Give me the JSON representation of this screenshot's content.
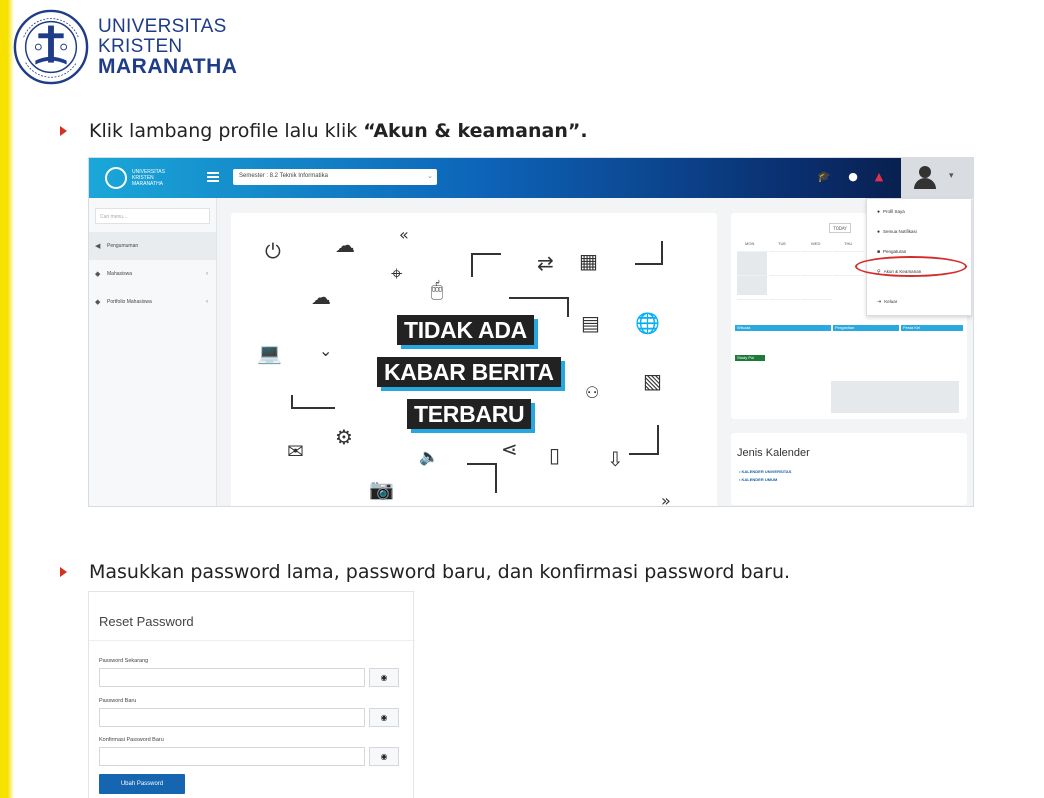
{
  "brand": {
    "line1": "UNIVERSITAS",
    "line2": "KRISTEN",
    "line3": "MARANATHA",
    "color": "#1f3c88"
  },
  "steps": [
    {
      "prefix": "Klik lambang profile lalu klik ",
      "quote_open": "“",
      "bold": "Akun & keamanan",
      "quote_close": "”."
    },
    {
      "text": "Masukkan password lama, password baru, dan konfirmasi password baru."
    }
  ],
  "portal": {
    "logo_text": [
      "UNIVERSITAS",
      "KRISTEN",
      "MARANATHA"
    ],
    "semester_select": "Semester : 8.2 Teknik Informatika",
    "search_placeholder": "Cari menu...",
    "sidebar": [
      {
        "icon": "megaphone-icon",
        "label": "Pengumuman"
      },
      {
        "icon": "grad-cap-icon",
        "label": "Mahasiswa"
      },
      {
        "icon": "grad-cap-icon",
        "label": "Portfolio Mahasiswa"
      }
    ],
    "news_banner": [
      "TIDAK ADA",
      "KABAR BERITA",
      "TERBARU"
    ],
    "calendar": {
      "today_button": "TODAY",
      "days": [
        "MON",
        "TUE",
        "WED",
        "THU",
        "FRI",
        "SAT",
        "SUN"
      ],
      "events": [
        "Wisuda",
        "Pergantian",
        "Pesta Kel"
      ],
      "event_green": "Study Pol"
    },
    "jenis_kalender": {
      "title": "Jenis Kalender",
      "items": [
        "• KALENDER UNIVERSITAS",
        "• KALENDER UMUM"
      ]
    },
    "profile_menu": [
      "Profil Saya",
      "Semua Notifikasi",
      "Pengaturan",
      "Akun & Keamanan",
      "Keluar"
    ],
    "highlight_color": "#d62b2b"
  },
  "reset_password": {
    "title": "Reset Password",
    "fields": [
      {
        "label": "Password Sekarang"
      },
      {
        "label": "Password Baru"
      },
      {
        "label": "Konfirmasi Password Baru"
      }
    ],
    "eye_icon": "eye-icon",
    "submit": "Ubah Password",
    "button_color": "#1565b0"
  },
  "colors": {
    "accent_stripe": "#f7e100",
    "bullet": "#d7301f"
  }
}
